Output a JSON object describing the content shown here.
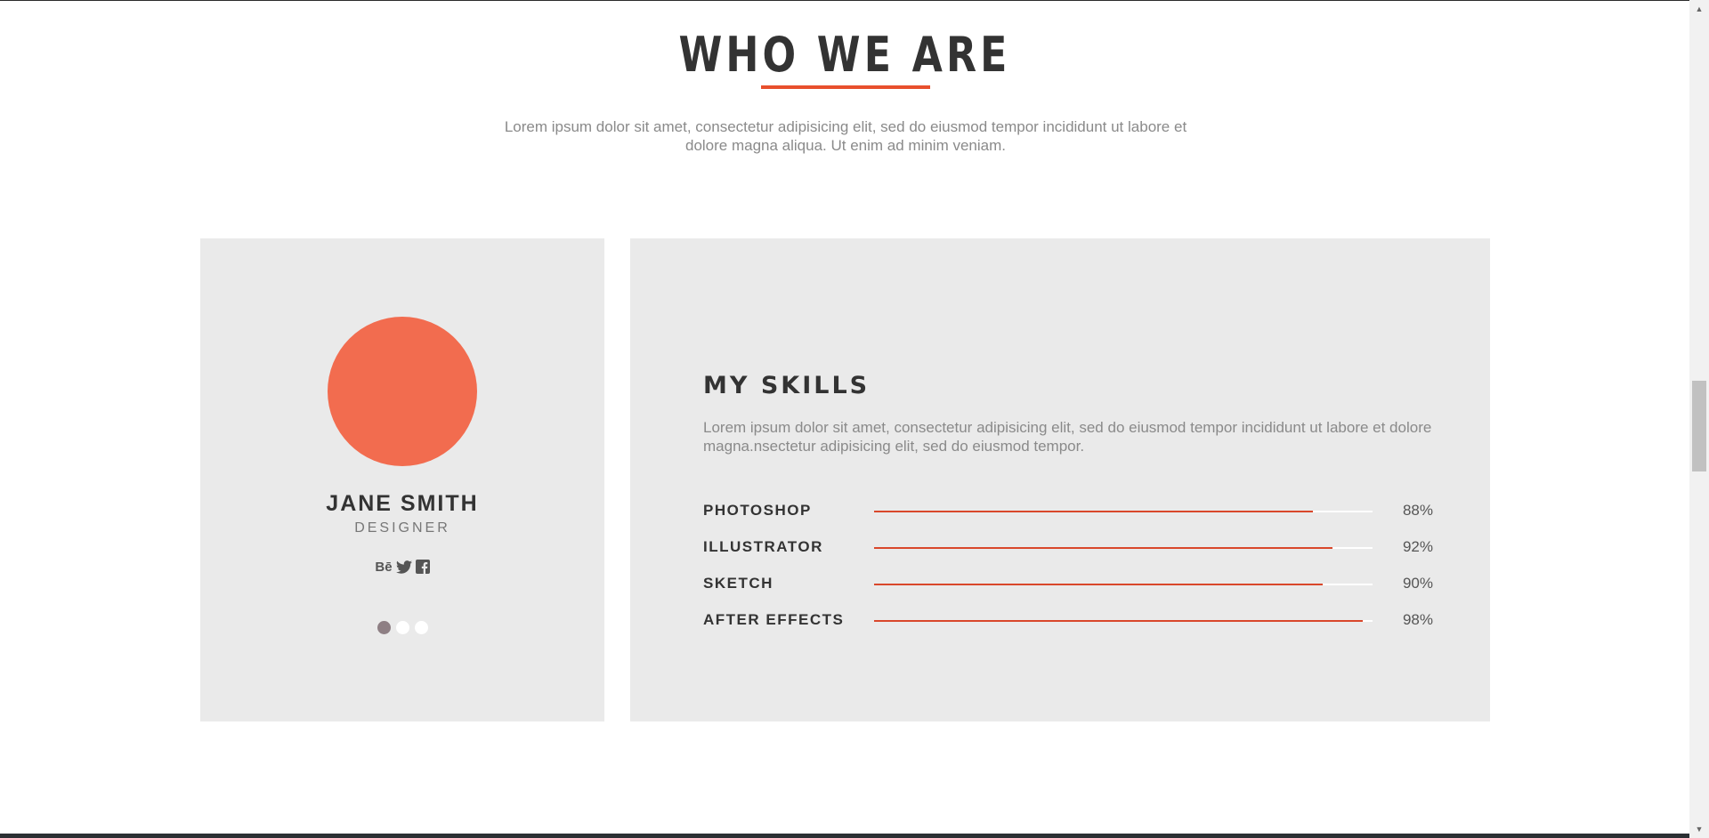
{
  "section": {
    "title": "WHO WE ARE",
    "subtitle": "Lorem ipsum dolor sit amet, consectetur adipisicing elit, sed do eiusmod tempor incididunt ut labore et dolore magna aliqua. Ut enim ad minim veniam."
  },
  "profile": {
    "name": "JANE SMITH",
    "role": "DESIGNER",
    "social": [
      {
        "icon": "behance-icon",
        "glyph": "Bē"
      },
      {
        "icon": "twitter-icon"
      },
      {
        "icon": "facebook-icon"
      }
    ],
    "carousel": {
      "count": 3,
      "active_index": 0
    }
  },
  "skills": {
    "title": "MY SKILLS",
    "description": "Lorem ipsum dolor sit amet, consectetur adipisicing elit, sed do eiusmod tempor incididunt ut labore et dolore magna.nsectetur adipisicing elit, sed do eiusmod tempor.",
    "items": [
      {
        "label": "PHOTOSHOP",
        "percent": 88,
        "percent_label": "88%"
      },
      {
        "label": "ILLUSTRATOR",
        "percent": 92,
        "percent_label": "92%"
      },
      {
        "label": "SKETCH",
        "percent": 90,
        "percent_label": "90%"
      },
      {
        "label": "AFTER EFFECTS",
        "percent": 98,
        "percent_label": "98%"
      }
    ]
  },
  "colors": {
    "accent": "#e8502d",
    "avatar": "#f26c4f",
    "bar_fill": "#d9472b",
    "card_bg": "#eaeaea"
  }
}
